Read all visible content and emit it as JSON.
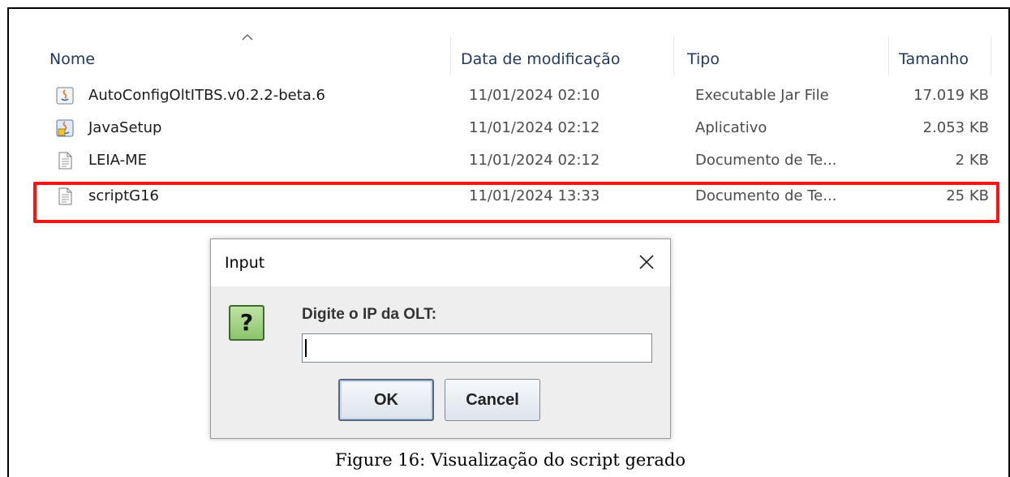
{
  "columns": {
    "name": "Nome",
    "modified": "Data de modificação",
    "type": "Tipo",
    "size": "Tamanho",
    "sort_icon": "chevron-up-icon"
  },
  "files": [
    {
      "name": "AutoConfigOltITBS.v0.2.2-beta.6",
      "modified": "11/01/2024 02:10",
      "type": "Executable Jar File",
      "size": "17.019 KB",
      "icon": "java-icon"
    },
    {
      "name": "JavaSetup",
      "modified": "11/01/2024 02:12",
      "type": "Aplicativo",
      "size": "2.053 KB",
      "icon": "java-installer-icon"
    },
    {
      "name": "LEIA-ME",
      "modified": "11/01/2024 02:12",
      "type": "Documento de Te...",
      "size": "2 KB",
      "icon": "text-document-icon"
    },
    {
      "name": "scriptG16",
      "modified": "11/01/2024 13:33",
      "type": "Documento de Te...",
      "size": "25 KB",
      "icon": "text-document-icon",
      "highlighted": true
    }
  ],
  "highlight_color": "#ff1212",
  "dialog": {
    "title": "Input",
    "close_symbol": "✕",
    "question_icon": "question-icon",
    "question_glyph": "?",
    "prompt": "Digite o IP da OLT:",
    "input_value": "",
    "ok_label": "OK",
    "cancel_label": "Cancel"
  },
  "caption": "Figure 16:  Visualização do script gerado"
}
